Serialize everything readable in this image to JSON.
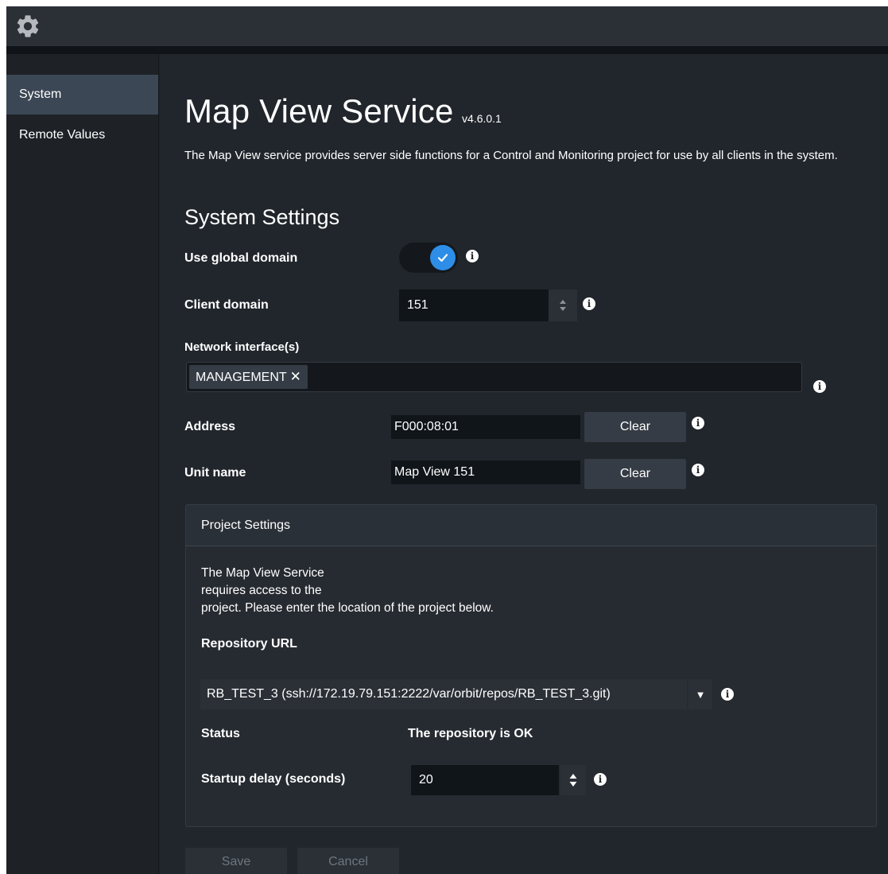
{
  "sidebar": {
    "items": [
      {
        "label": "System",
        "active": true
      },
      {
        "label": "Remote Values",
        "active": false
      }
    ]
  },
  "header": {
    "title": "Map View Service",
    "version": "v4.6.0.1",
    "description": "The Map View service provides server side functions for a Control and Monitoring project for use by all clients in the system."
  },
  "system_settings": {
    "title": "System Settings",
    "use_global_domain": {
      "label": "Use global domain",
      "checked": true
    },
    "client_domain": {
      "label": "Client domain",
      "value": "151"
    },
    "network_interfaces": {
      "label": "Network interface(s)",
      "tags": [
        "MANAGEMENT"
      ]
    },
    "address": {
      "label": "Address",
      "value": "F000:08:01",
      "clear_label": "Clear"
    },
    "unit_name": {
      "label": "Unit name",
      "value": "Map View 151",
      "clear_label": "Clear"
    }
  },
  "project_settings": {
    "title": "Project Settings",
    "text_line1": "The Map View Service",
    "text_line2": "requires access to the",
    "text_line3": "project. Please enter the location of the project below.",
    "repo_label": "Repository URL",
    "repo_value": "RB_TEST_3 (ssh://172.19.79.151:2222/var/orbit/repos/RB_TEST_3.git)",
    "status_label": "Status",
    "status_value": "The repository is OK",
    "startup_delay_label": "Startup delay (seconds)",
    "startup_delay_value": "20"
  },
  "footer": {
    "save_label": "Save",
    "cancel_label": "Cancel"
  },
  "icons": {
    "settings": "gear-icon",
    "info": "info-icon",
    "check": "check-icon",
    "remove": "close-icon",
    "dropdown": "caret-down-icon",
    "spinner": "spinner-arrows-icon"
  },
  "colors": {
    "accent": "#2e8de6",
    "sidebar_active": "#3b4754",
    "background": "#21262c"
  }
}
